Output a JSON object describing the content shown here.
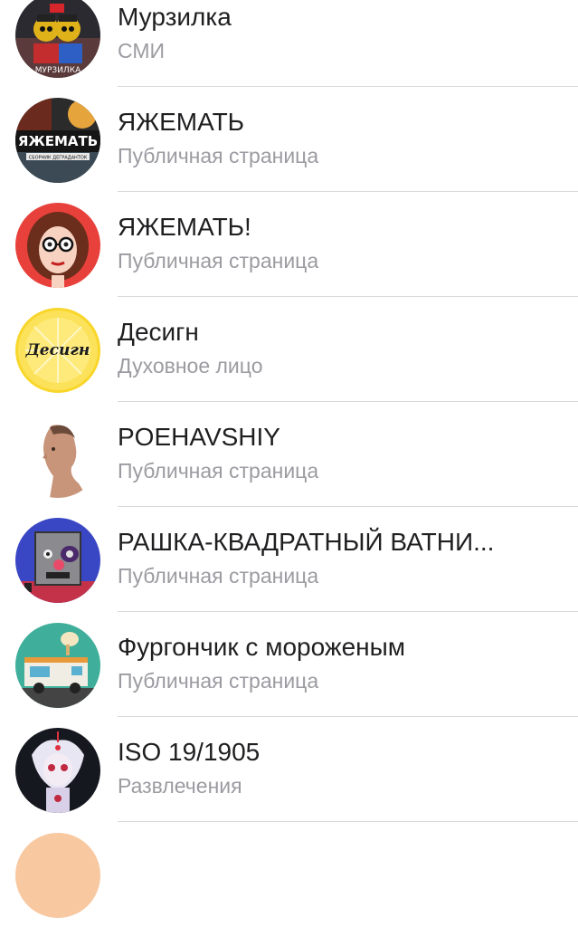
{
  "communities": [
    {
      "name": "Мурзилка",
      "subtitle": "СМИ",
      "avatar_icon": "murzilka-avatar-icon"
    },
    {
      "name": "ЯЖЕМАТЬ",
      "subtitle": "Публичная страница",
      "avatar_icon": "yazhemat-avatar-icon"
    },
    {
      "name": "ЯЖЕМАТЬ!",
      "subtitle": "Публичная страница",
      "avatar_icon": "cartoon-woman-avatar-icon"
    },
    {
      "name": "Десигн",
      "subtitle": "Духовное лицо",
      "avatar_icon": "lemon-avatar-icon"
    },
    {
      "name": "POEHAVSHIY",
      "subtitle": "Публичная страница",
      "avatar_icon": "man-profile-avatar-icon"
    },
    {
      "name": "РАШКА-КВАДРАТНЫЙ ВАТНИ...",
      "subtitle": "Публичная страница",
      "avatar_icon": "square-face-avatar-icon"
    },
    {
      "name": "Фургончик с мороженым",
      "subtitle": "Публичная страница",
      "avatar_icon": "ice-cream-truck-avatar-icon"
    },
    {
      "name": "ISO 19/1905",
      "subtitle": "Развлечения",
      "avatar_icon": "anime-girl-avatar-icon"
    }
  ],
  "avatar_texts": {
    "murzilka_caption": "МУРЗИЛКА",
    "yazhemat_banner": "ЯЖЕМАТЬ",
    "yazhemat_sub": "СБОРНИК ДЕГРАДАНТОК",
    "lemon_word": "Десигн"
  }
}
